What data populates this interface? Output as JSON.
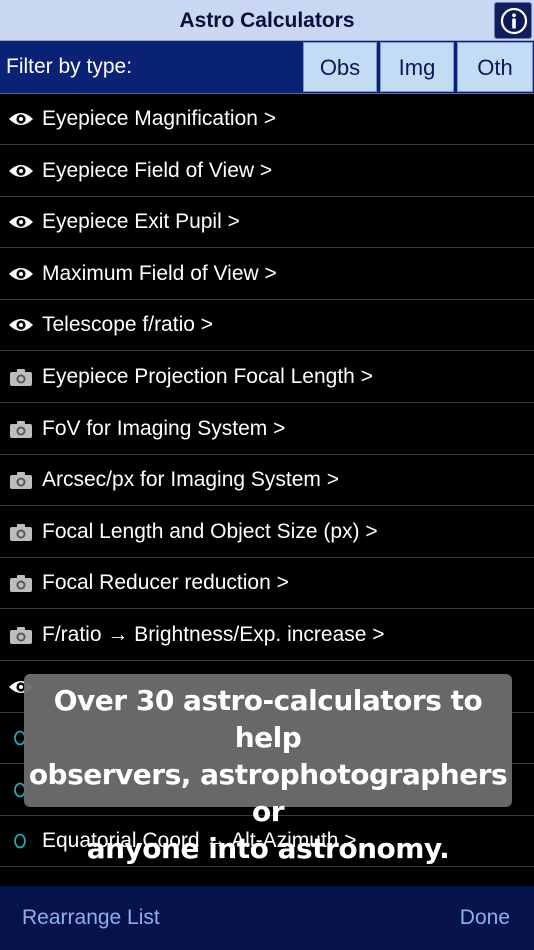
{
  "header": {
    "title": "Astro Calculators",
    "info_icon": "info-icon"
  },
  "filter": {
    "label": "Filter by type:",
    "buttons": [
      {
        "label": "Obs"
      },
      {
        "label": "Img"
      },
      {
        "label": "Oth"
      }
    ]
  },
  "list": {
    "items": [
      {
        "icon": "eye-icon",
        "label": "Eyepiece Magnification >"
      },
      {
        "icon": "eye-icon",
        "label": "Eyepiece Field of View >"
      },
      {
        "icon": "eye-icon",
        "label": "Eyepiece Exit Pupil >"
      },
      {
        "icon": "eye-icon",
        "label": "Maximum Field of View >"
      },
      {
        "icon": "eye-icon",
        "label": "Telescope f/ratio >"
      },
      {
        "icon": "camera-icon",
        "label": "Eyepiece Projection Focal Length >"
      },
      {
        "icon": "camera-icon",
        "label": "FoV for Imaging System >"
      },
      {
        "icon": "camera-icon",
        "label": "Arcsec/px for Imaging System >"
      },
      {
        "icon": "camera-icon",
        "label": "Focal Length and Object Size (px) >"
      },
      {
        "icon": "camera-icon",
        "label": "Focal Reducer reduction >"
      },
      {
        "icon": "camera-icon",
        "label": "F/ratio → Brightness/Exp. increase >"
      },
      {
        "icon": "eye-icon",
        "label": ""
      },
      {
        "icon": "circle-icon",
        "label": ""
      },
      {
        "icon": "circle-icon",
        "label": ""
      },
      {
        "icon": "circle-icon",
        "label": "Equatorial Coord ↔ Alt-Azimuth >"
      }
    ]
  },
  "overlay": {
    "lines": [
      "Over 30 astro-calculators to help",
      "observers, astrophotographers or",
      "anyone into astronomy."
    ]
  },
  "footer": {
    "left_label": "Rearrange List",
    "right_label": "Done"
  },
  "colors": {
    "title_bg": "#c9d7f2",
    "filter_bg": "#0a2276",
    "filter_button_bg": "#c4dbf6",
    "footer_bg": "#06124a",
    "footer_text": "#8bb0f2",
    "circle_icon": "#1fa6b0"
  }
}
